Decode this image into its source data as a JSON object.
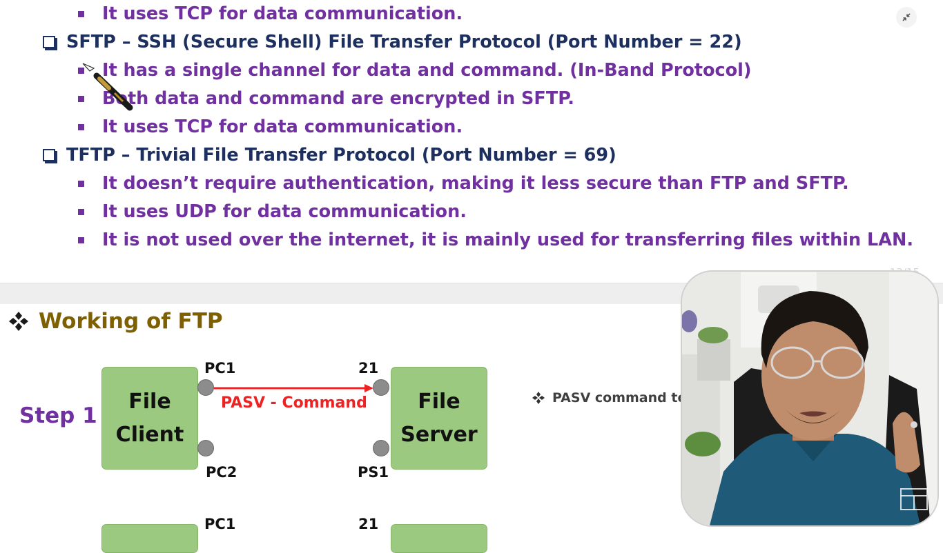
{
  "slide1": {
    "items": [
      {
        "level": 2,
        "text": "It uses TCP for data communication."
      },
      {
        "level": 1,
        "text": "SFTP – SSH (Secure Shell) File Transfer Protocol (Port Number = 22)"
      },
      {
        "level": 2,
        "text": "It has a single channel for data and command. (In-Band Protocol)"
      },
      {
        "level": 2,
        "text": "Both data and command are encrypted in SFTP."
      },
      {
        "level": 2,
        "text": "It uses TCP for data communication."
      },
      {
        "level": 1,
        "text": "TFTP – Trivial File Transfer Protocol (Port Number = 69)"
      },
      {
        "level": 2,
        "text": "It doesn’t require authentication, making it less secure than FTP and SFTP."
      },
      {
        "level": 2,
        "text": "It uses UDP for data communication."
      },
      {
        "level": 2,
        "text": "It is not used over the internet, it is mainly used for transferring files within LAN."
      }
    ],
    "page_number": "13/15"
  },
  "slide2": {
    "title": "Working of FTP",
    "step1": {
      "label": "Step 1",
      "client": {
        "line1": "File",
        "line2": "Client"
      },
      "server": {
        "line1": "File",
        "line2": "Server"
      },
      "ports": {
        "pc1": "PC1",
        "pc2": "PC2",
        "p21": "21",
        "ps1": "PS1"
      },
      "command": "PASV - Command"
    },
    "note": "PASV command to",
    "step2_ports": {
      "pc1": "PC1",
      "p21": "21"
    }
  },
  "icons": [
    "minimize-icon",
    "pen-pointer-icon",
    "diamond-bullet-icon",
    "brand-logo-icon"
  ],
  "colors": {
    "heading": "#1d2f5e",
    "bullet_text": "#7030a0",
    "section_title": "#7f6000",
    "box_fill": "#9bc97f",
    "command": "#ee2222"
  }
}
